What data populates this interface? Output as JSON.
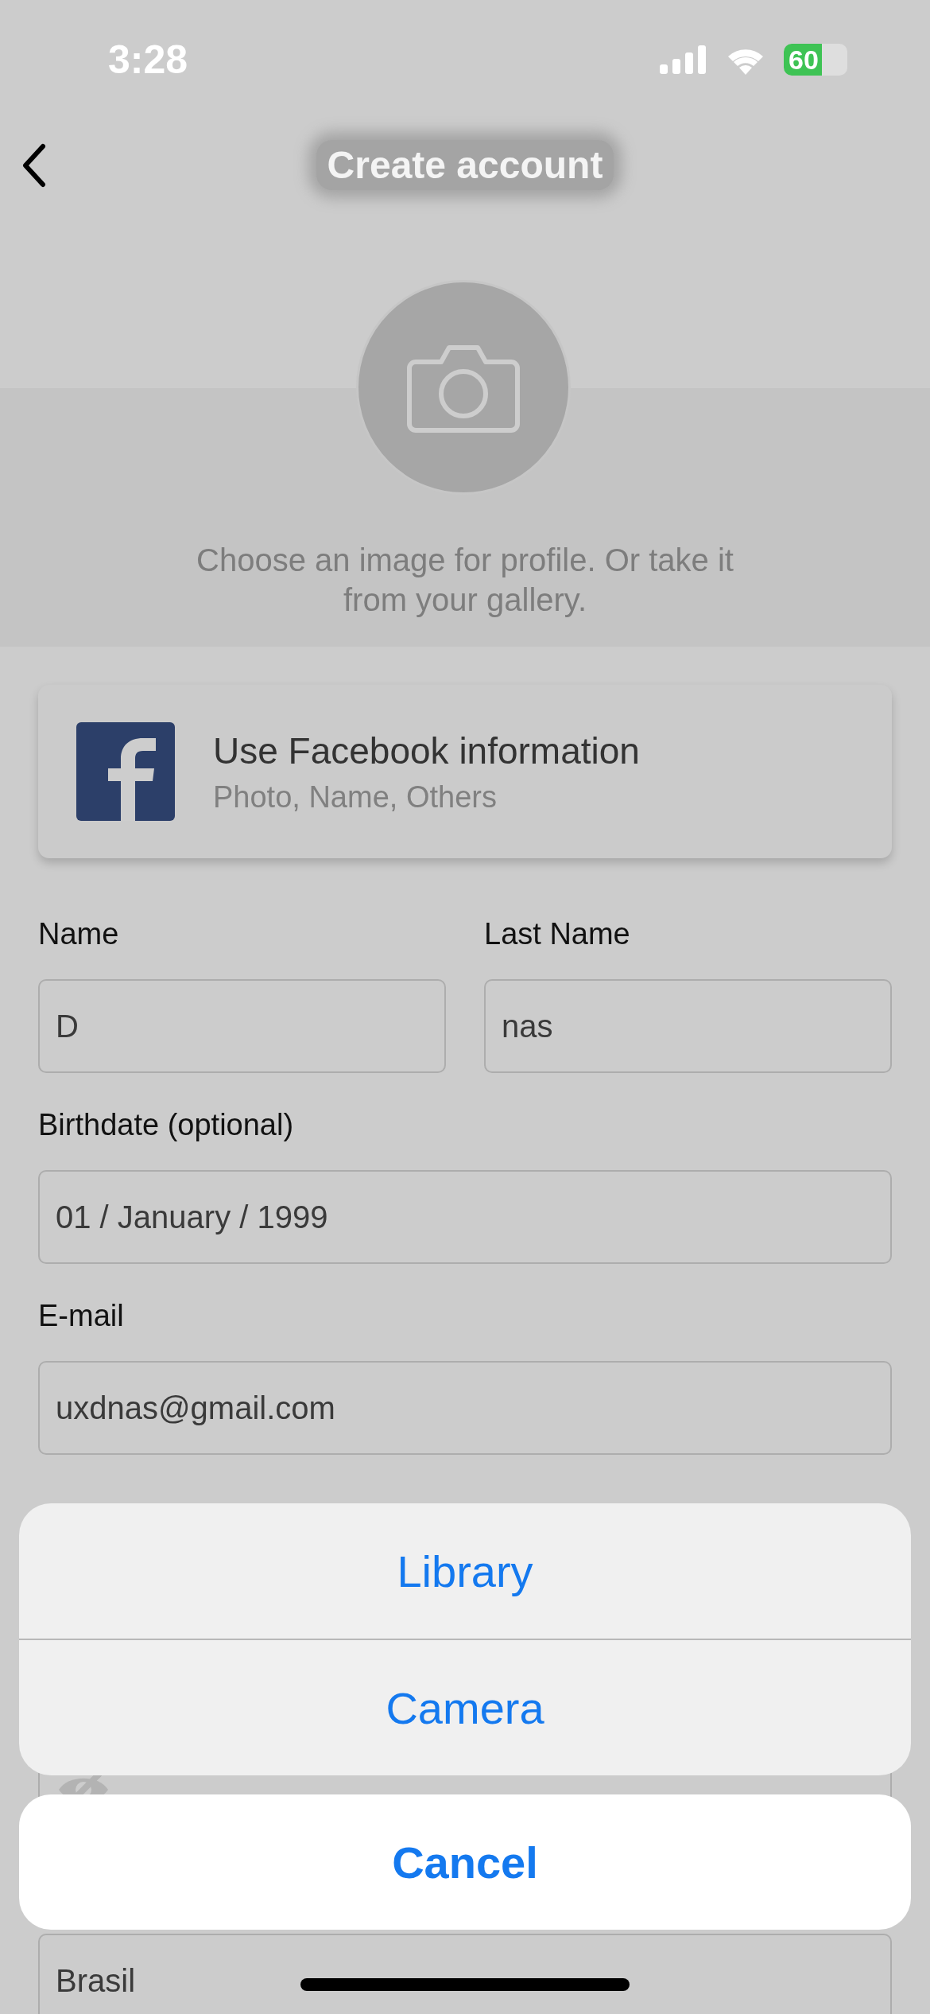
{
  "status_bar": {
    "time": "3:28",
    "battery": "60"
  },
  "header": {
    "title": "Create account"
  },
  "avatar": {
    "caption": "Choose an image for profile. Or take it from your gallery."
  },
  "facebook": {
    "title": "Use Facebook information",
    "subtitle": "Photo, Name, Others"
  },
  "form": {
    "rows": [
      {
        "fields": [
          {
            "kind": "text",
            "label": "Name",
            "value": "D"
          },
          {
            "kind": "text",
            "label": "Last Name",
            "value": "nas"
          }
        ]
      },
      {
        "fields": [
          {
            "kind": "text",
            "label": "Birthdate (optional)",
            "value": "01 / January / 1999"
          }
        ]
      },
      {
        "fields": [
          {
            "kind": "text",
            "label": "E-mail",
            "value": "uxdnas@gmail.com"
          }
        ]
      },
      {
        "fields": [
          {
            "kind": "password"
          }
        ]
      },
      {
        "fields": [
          {
            "kind": "text",
            "value": "Brasil"
          }
        ]
      }
    ]
  },
  "action_sheet": {
    "options": [
      "Library",
      "Camera"
    ],
    "cancel": "Cancel"
  }
}
